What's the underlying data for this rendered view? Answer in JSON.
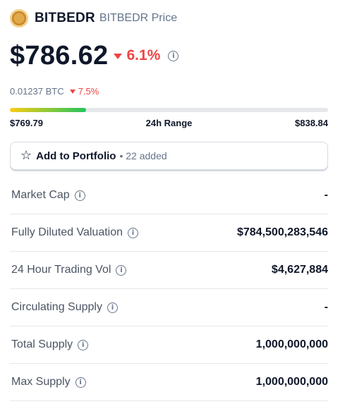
{
  "coin": {
    "symbol": "BITBEDR",
    "subtitle": "BITBEDR Price",
    "logo_color": "#e0a94a"
  },
  "price": {
    "value": "$786.62",
    "change": "6.1%",
    "direction": "down",
    "change_color": "#ef4444"
  },
  "btc": {
    "value": "0.01237 BTC",
    "change": "7.5%"
  },
  "range": {
    "low": "$769.79",
    "label": "24h Range",
    "high": "$838.84",
    "fill_fraction": 0.24
  },
  "portfolio": {
    "button_label": "Add to Portfolio",
    "added_text": "• 22 added"
  },
  "stats": [
    {
      "label": "Market Cap",
      "value": "-"
    },
    {
      "label": "Fully Diluted Valuation",
      "value": "$784,500,283,546"
    },
    {
      "label": "24 Hour Trading Vol",
      "value": "$4,627,884"
    },
    {
      "label": "Circulating Supply",
      "value": "-"
    },
    {
      "label": "Total Supply",
      "value": "1,000,000,000"
    },
    {
      "label": "Max Supply",
      "value": "1,000,000,000"
    }
  ]
}
